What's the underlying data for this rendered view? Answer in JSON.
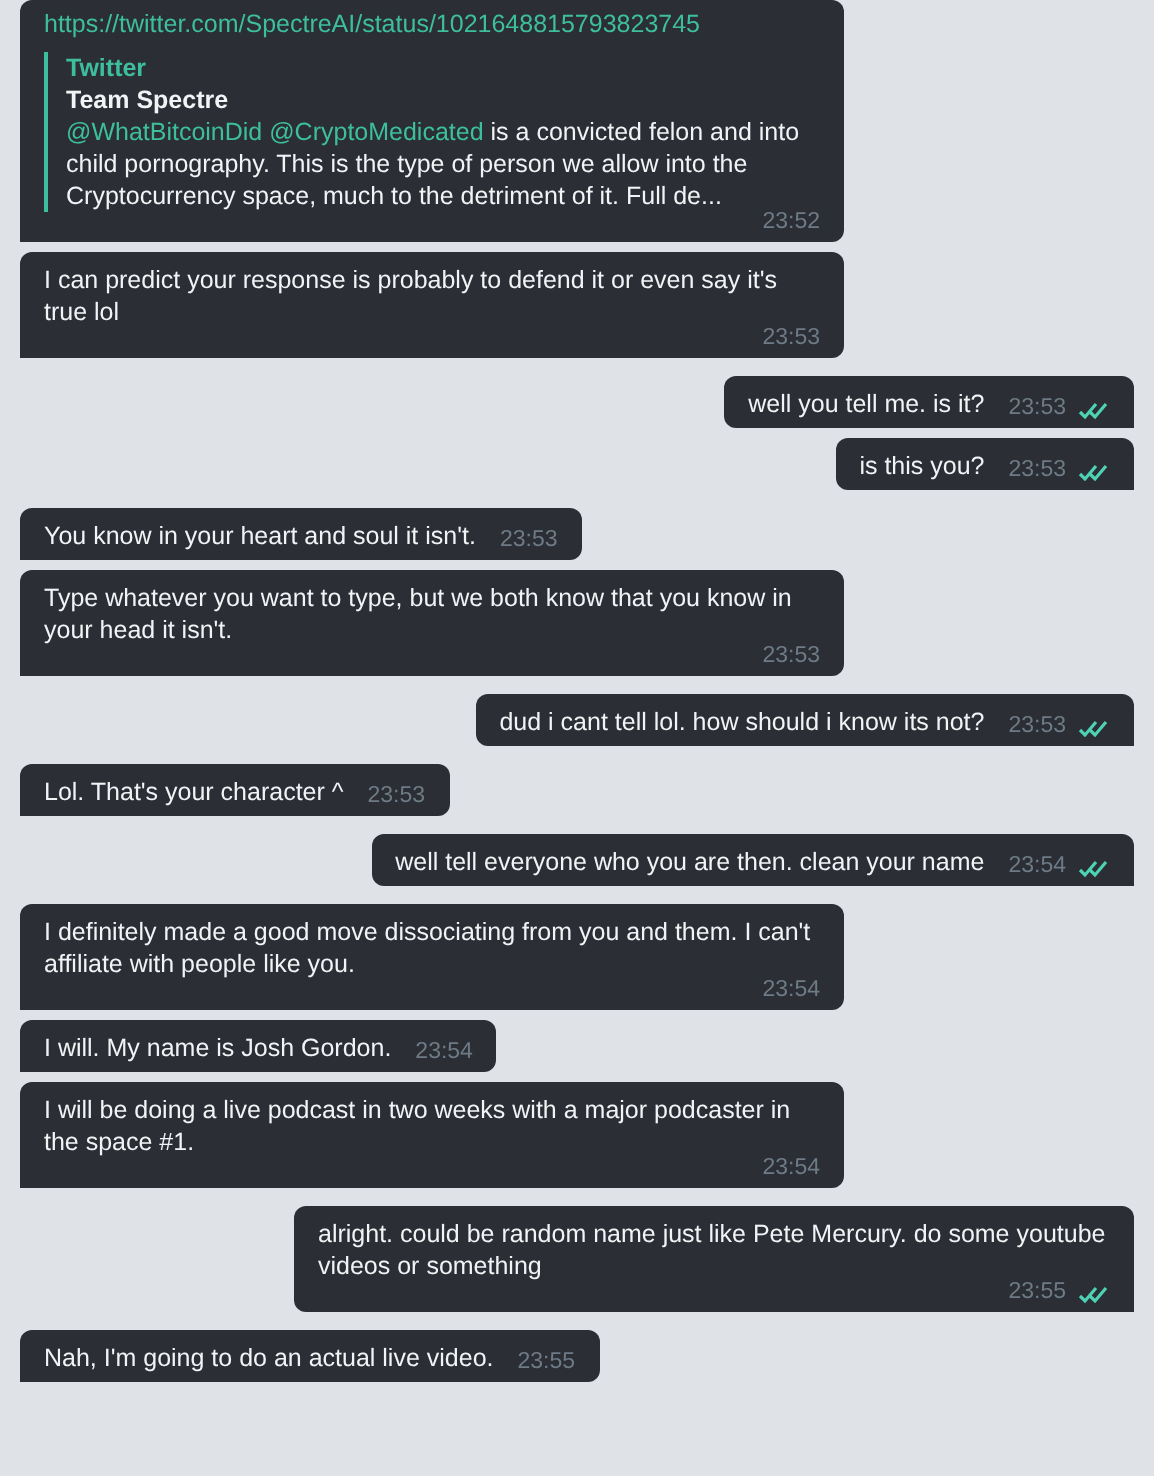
{
  "messages": [
    {
      "outgoing": false,
      "kind": "link",
      "url": "https://twitter.com/SpectreAI/status/1021648815793823745",
      "preview": {
        "site": "Twitter",
        "title": "Team Spectre",
        "mentions": "@WhatBitcoinDid @CryptoMedicated",
        "text": " is a convicted felon and into child pornography. This is the type of person we allow into the Cryptocurrency space, much to the detriment of it. Full de..."
      },
      "time": "23:52"
    },
    {
      "outgoing": false,
      "kind": "text",
      "text": "I can predict your response is probably to defend it or even say it's true lol",
      "time": "23:53"
    },
    {
      "outgoing": true,
      "kind": "text",
      "text": "well you tell me. is it?",
      "time": "23:53",
      "read": true
    },
    {
      "outgoing": true,
      "kind": "text",
      "text": "is this you?",
      "time": "23:53",
      "read": true
    },
    {
      "outgoing": false,
      "kind": "text",
      "text": "You know in your heart and soul it isn't.",
      "time": "23:53"
    },
    {
      "outgoing": false,
      "kind": "text",
      "text": "Type whatever you want to type, but we both know that you know in your head it isn't.",
      "time": "23:53"
    },
    {
      "outgoing": true,
      "kind": "text",
      "text": "dud i cant tell lol. how should i know its not?",
      "time": "23:53",
      "read": true
    },
    {
      "outgoing": false,
      "kind": "text",
      "text": "Lol. That's your character ^",
      "time": "23:53"
    },
    {
      "outgoing": true,
      "kind": "text",
      "text": "well tell everyone who you are then. clean your name",
      "time": "23:54",
      "read": true
    },
    {
      "outgoing": false,
      "kind": "text",
      "text": "I definitely made a good move dissociating from you and them. I can't affiliate with people like you.",
      "time": "23:54"
    },
    {
      "outgoing": false,
      "kind": "text",
      "text": "I will. My name is Josh Gordon.",
      "time": "23:54"
    },
    {
      "outgoing": false,
      "kind": "text",
      "text": "I will be doing a live podcast in two weeks with a major podcaster in the space #1.",
      "time": "23:54"
    },
    {
      "outgoing": true,
      "kind": "text",
      "text": "alright. could be random name just like Pete Mercury. do some youtube videos or something",
      "time": "23:55",
      "read": true
    },
    {
      "outgoing": false,
      "kind": "text",
      "text": "Nah, I'm going to do an actual live video.",
      "time": "23:55"
    }
  ]
}
